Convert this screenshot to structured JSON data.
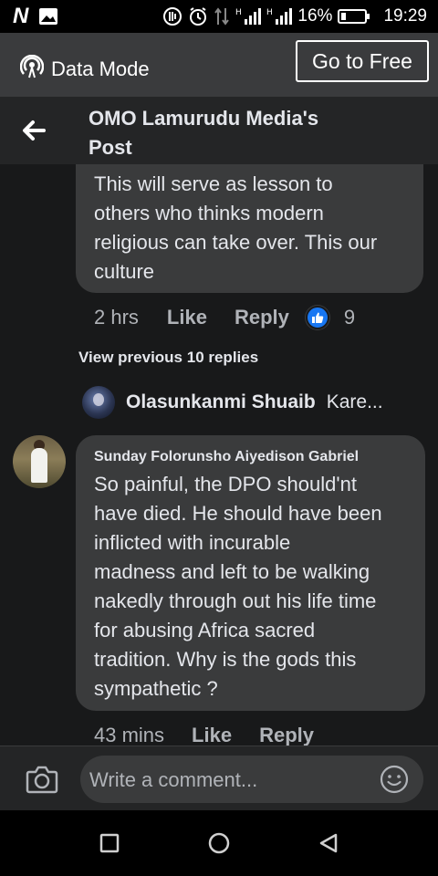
{
  "status_bar": {
    "left_icons": [
      "n-logo-icon",
      "image-icon"
    ],
    "battery_percent": "16%",
    "time": "19:29"
  },
  "data_bar": {
    "label": "Data Mode",
    "go_free_label": "Go to Free"
  },
  "header": {
    "title_line1": "OMO Lamurudu Media's",
    "title_line2": "Post"
  },
  "comment1": {
    "lines": [
      "This will serve as lesson to",
      "others who thinks modern",
      "religious can take over. This our",
      "culture"
    ],
    "time": "2 hrs",
    "like_label": "Like",
    "reply_label": "Reply",
    "reaction_count": "9"
  },
  "view_previous": "View previous 10 replies",
  "reply_preview": {
    "name": "Olasunkanmi Shuaib",
    "text": "Kare..."
  },
  "comment2": {
    "author": "Sunday Folorunsho Aiyedison Gabriel",
    "lines": [
      "So painful, the DPO should'nt",
      "have died. He should have been",
      "inflicted with incurable",
      "madness and left to be walking",
      "nakedly through out his life time",
      "for abusing Africa sacred",
      "tradition. Why is the gods this",
      "sympathetic ?"
    ],
    "time": "43 mins",
    "like_label": "Like",
    "reply_label": "Reply"
  },
  "composer": {
    "placeholder": "Write a comment..."
  },
  "colors": {
    "background": "#18191a",
    "bubble": "#3a3b3c",
    "header": "#242526",
    "like_blue": "#1877f2",
    "secondary_text": "#b0b3b8"
  }
}
